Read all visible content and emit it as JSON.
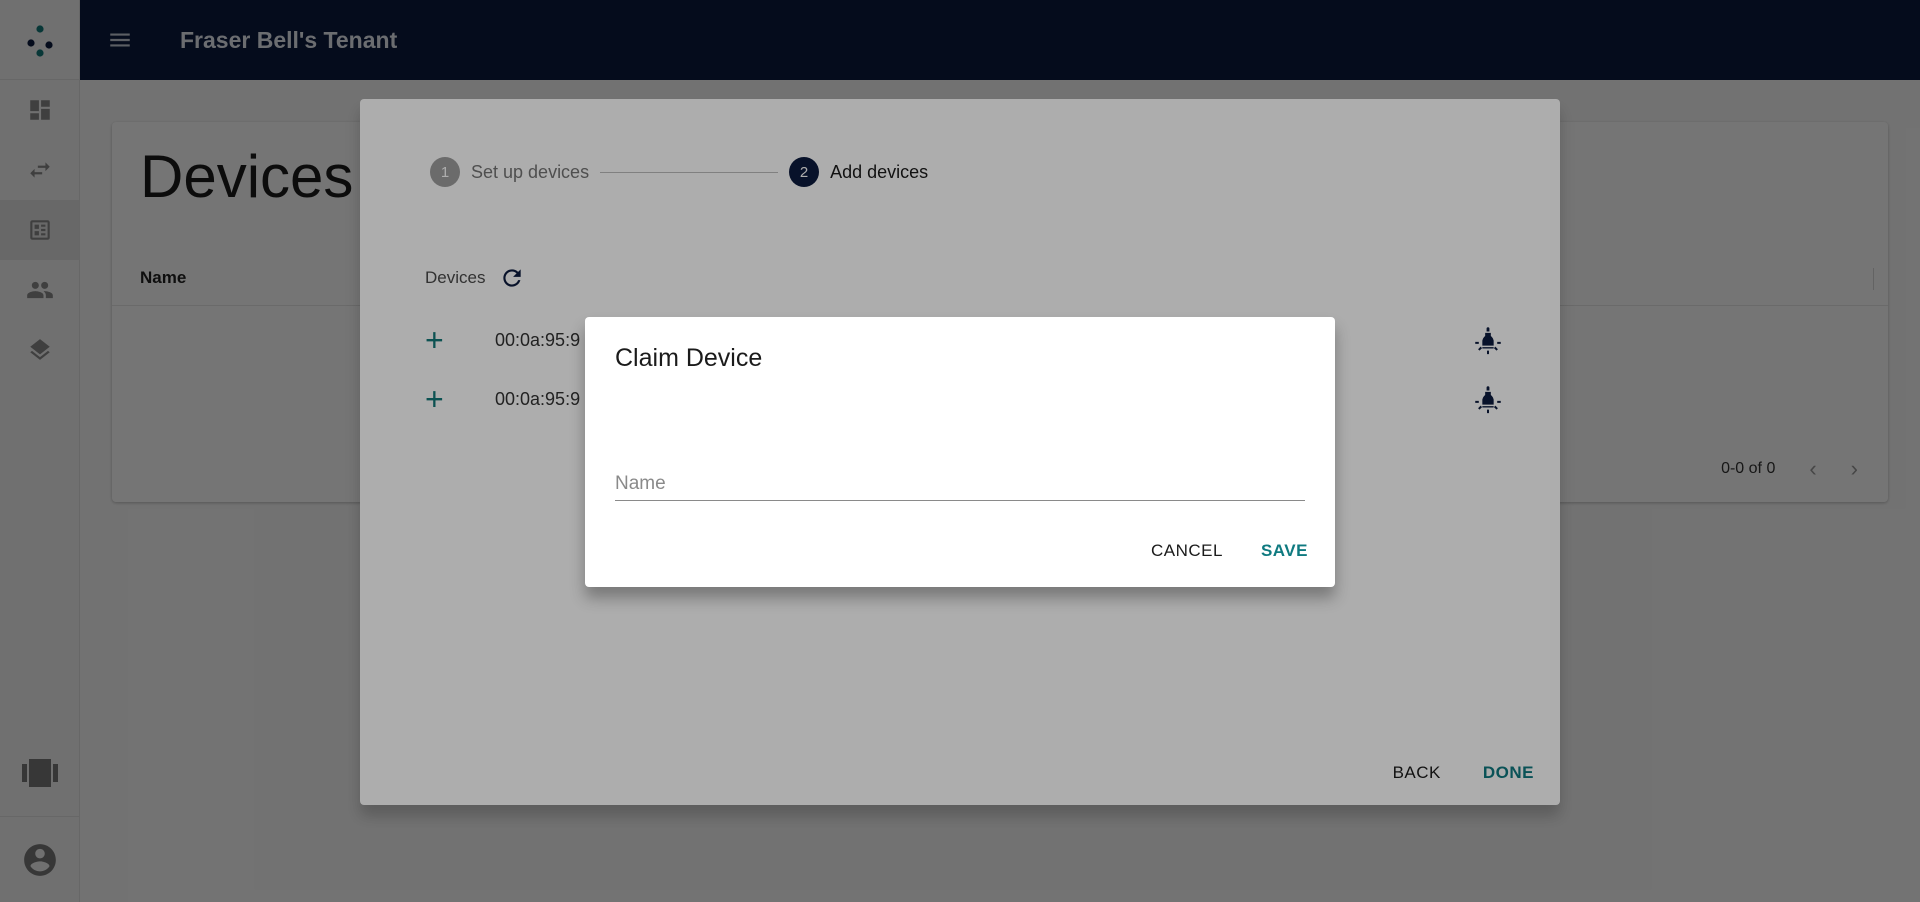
{
  "header": {
    "tenant_title": "Fraser Bell's Tenant"
  },
  "sidebar": {
    "items": [
      {
        "icon": "dashboard-icon"
      },
      {
        "icon": "swap-arrows-icon"
      },
      {
        "icon": "devices-icon",
        "active": true
      },
      {
        "icon": "people-icon"
      },
      {
        "icon": "layers-icon"
      }
    ],
    "bottom": [
      {
        "icon": "carousel-icon"
      },
      {
        "icon": "account-icon"
      }
    ]
  },
  "page": {
    "title": "Devices",
    "table": {
      "columns": [
        "Name"
      ]
    },
    "pagination": {
      "range_text": "0-0 of 0"
    }
  },
  "wizard": {
    "steps": [
      {
        "number": "1",
        "label": "Set up devices"
      },
      {
        "number": "2",
        "label": "Add devices"
      }
    ],
    "devices_label": "Devices",
    "devices": [
      {
        "address": "00:0a:95:9"
      },
      {
        "address": "00:0a:95:9"
      }
    ],
    "back_label": "BACK",
    "done_label": "DONE"
  },
  "claim_dialog": {
    "title": "Claim Device",
    "name_placeholder": "Name",
    "name_value": "",
    "cancel_label": "CANCEL",
    "save_label": "SAVE"
  },
  "colors": {
    "topbar": "#0d1b3e",
    "accent": "#0f7a80",
    "step_active": "#0d1b3e"
  }
}
